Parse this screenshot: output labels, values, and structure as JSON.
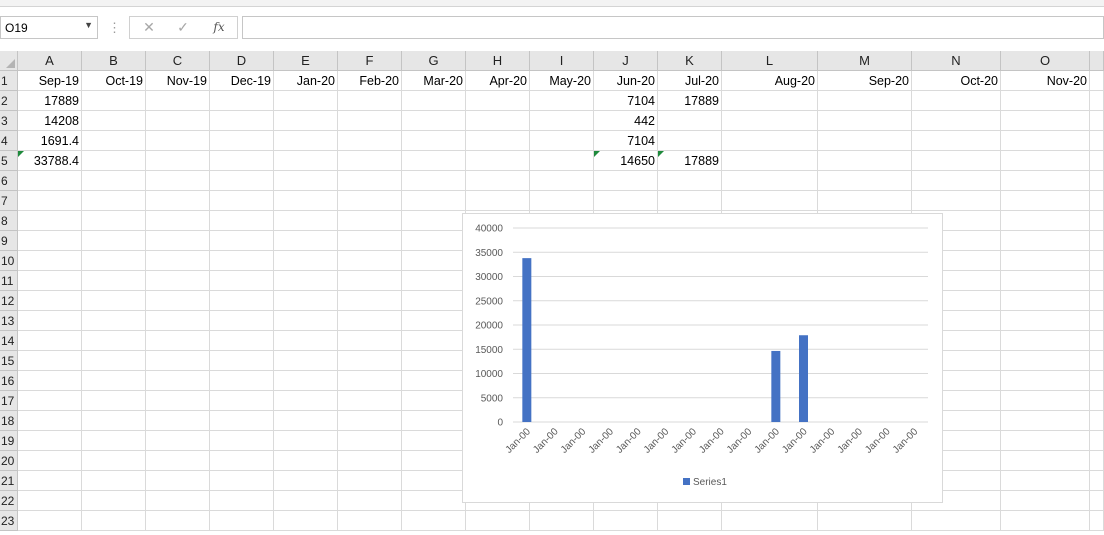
{
  "name_box": {
    "value": "O19"
  },
  "formula_bar": {
    "fx_label": "fx",
    "cancel_glyph": "✕",
    "enter_glyph": "✓",
    "value": ""
  },
  "columns": [
    "A",
    "B",
    "C",
    "D",
    "E",
    "F",
    "G",
    "H",
    "I",
    "J",
    "K",
    "L",
    "M",
    "N",
    "O"
  ],
  "row_numbers": [
    "1",
    "2",
    "3",
    "4",
    "5",
    "6",
    "7",
    "8",
    "9",
    "10",
    "11",
    "12",
    "13",
    "14",
    "15",
    "16",
    "17",
    "18",
    "19",
    "20",
    "21",
    "22",
    "23"
  ],
  "rows": [
    [
      "Sep-19",
      "Oct-19",
      "Nov-19",
      "Dec-19",
      "Jan-20",
      "Feb-20",
      "Mar-20",
      "Apr-20",
      "May-20",
      "Jun-20",
      "Jul-20",
      "Aug-20",
      "Sep-20",
      "Oct-20",
      "Nov-20"
    ],
    [
      "17889",
      "",
      "",
      "",
      "",
      "",
      "",
      "",
      "",
      "7104",
      "17889",
      "",
      "",
      "",
      ""
    ],
    [
      "14208",
      "",
      "",
      "",
      "",
      "",
      "",
      "",
      "",
      "442",
      "",
      "",
      "",
      "",
      ""
    ],
    [
      "1691.4",
      "",
      "",
      "",
      "",
      "",
      "",
      "",
      "",
      "7104",
      "",
      "",
      "",
      "",
      ""
    ],
    [
      "33788.4",
      "",
      "",
      "",
      "",
      "",
      "",
      "",
      "",
      "14650",
      "17889",
      "",
      "",
      "",
      ""
    ]
  ],
  "error_flag_cells": [
    "A5",
    "J5",
    "K5"
  ],
  "colors": {
    "bar": "#4472c4",
    "gridline": "#d9d9d9",
    "axis_text": "#595959",
    "error_flag": "#1e8a3c"
  },
  "chart_data": {
    "type": "bar",
    "title": "",
    "categories": [
      "Jan-00",
      "Jan-00",
      "Jan-00",
      "Jan-00",
      "Jan-00",
      "Jan-00",
      "Jan-00",
      "Jan-00",
      "Jan-00",
      "Jan-00",
      "Jan-00",
      "Jan-00",
      "Jan-00",
      "Jan-00",
      "Jan-00"
    ],
    "series": [
      {
        "name": "Series1",
        "values": [
          33788.4,
          0,
          0,
          0,
          0,
          0,
          0,
          0,
          0,
          14650,
          17889,
          0,
          0,
          0,
          0
        ]
      }
    ],
    "ylim": [
      0,
      40000
    ],
    "yticks": [
      "40000",
      "35000",
      "30000",
      "25000",
      "20000",
      "15000",
      "10000",
      "5000",
      "0"
    ],
    "grid": true,
    "legend": "bottom"
  }
}
